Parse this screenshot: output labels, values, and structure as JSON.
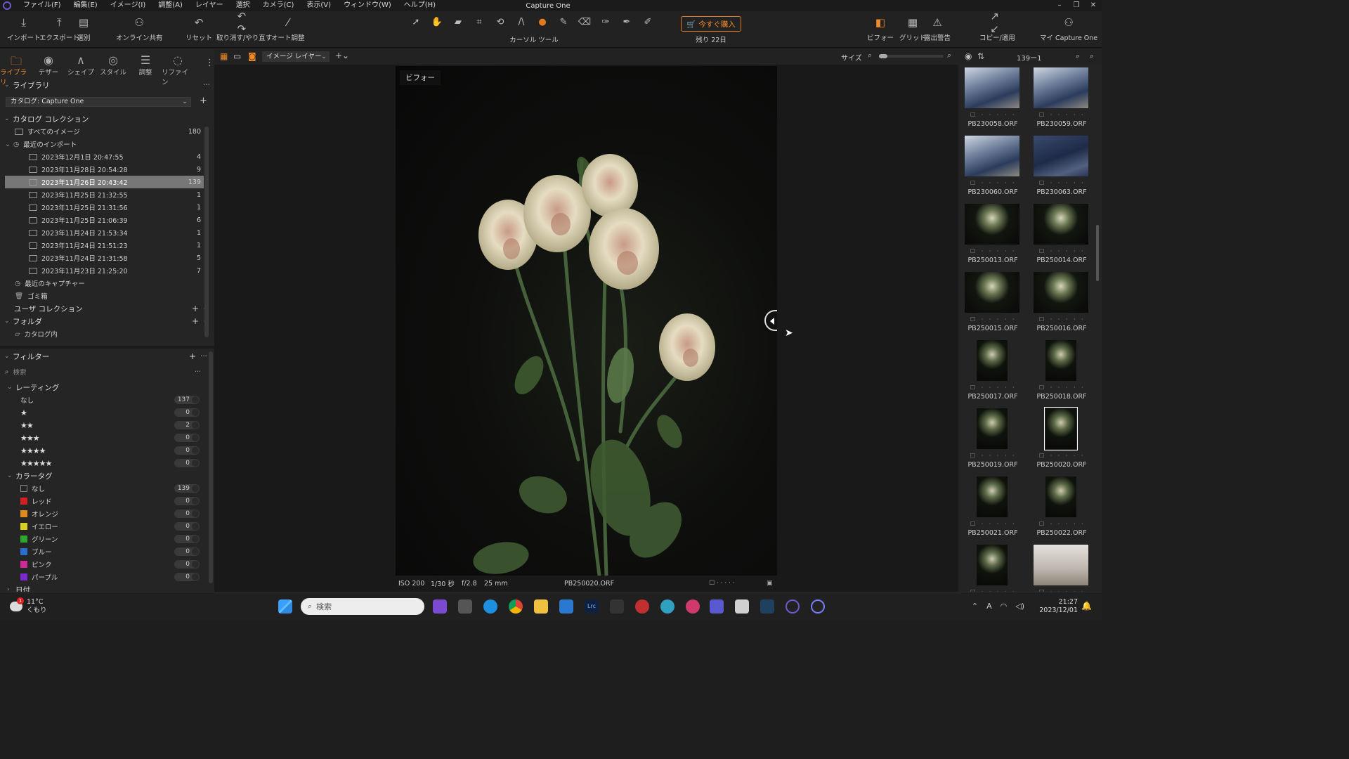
{
  "app": {
    "title": "Capture One",
    "menu": [
      "ファイル(F)",
      "編集(E)",
      "イメージ(I)",
      "調整(A)",
      "レイヤー",
      "選択",
      "カメラ(C)",
      "表示(V)",
      "ウィンドウ(W)",
      "ヘルプ(H)"
    ],
    "window_controls": [
      "–",
      "❐",
      "✕"
    ]
  },
  "toolbar": {
    "import": "インポート",
    "export": "エクスポート",
    "select": "選別",
    "online_share": "オンライン共有",
    "reset": "リセット",
    "undo_redo": "取り消す/やり直す",
    "auto_adjust": "オート調整",
    "cursor_tools": "カーソル ツール",
    "buy_now": "今すぐ購入",
    "days_left": "残り 22日",
    "before": "ビフォー",
    "grid": "グリッド",
    "exposure_warning": "露出警告",
    "copy_apply": "コピー/適用",
    "my_capture_one": "マイ Capture One"
  },
  "left_panel": {
    "tabs": [
      {
        "label": "ライブラリ",
        "icon": "folder-icon",
        "glyph": "🗀"
      },
      {
        "label": "テザー",
        "icon": "camera-icon",
        "glyph": "◉"
      },
      {
        "label": "シェイプ",
        "icon": "shape-icon",
        "glyph": "∧"
      },
      {
        "label": "スタイル",
        "icon": "style-icon",
        "glyph": "◎"
      },
      {
        "label": "調整",
        "icon": "sliders-icon",
        "glyph": "☰"
      },
      {
        "label": "リファイン",
        "icon": "refine-icon",
        "glyph": "◌"
      }
    ],
    "library": {
      "title": "ライブラリ",
      "catalog_select": "カタログ: Capture One",
      "catalog_collections": "カタログ コレクション",
      "all_images": {
        "label": "すべてのイメージ",
        "count": "180"
      },
      "recent_imports": "最近のインポート",
      "imports": [
        {
          "label": "2023年12月1日 20:47:55",
          "count": "4"
        },
        {
          "label": "2023年11月28日 20:54:28",
          "count": "9"
        },
        {
          "label": "2023年11月26日 20:43:42",
          "count": "139"
        },
        {
          "label": "2023年11月25日 21:32:55",
          "count": "1"
        },
        {
          "label": "2023年11月25日 21:31:56",
          "count": "1"
        },
        {
          "label": "2023年11月25日 21:06:39",
          "count": "6"
        },
        {
          "label": "2023年11月24日 21:53:34",
          "count": "1"
        },
        {
          "label": "2023年11月24日 21:51:23",
          "count": "1"
        },
        {
          "label": "2023年11月24日 21:31:58",
          "count": "5"
        },
        {
          "label": "2023年11月23日 21:25:20",
          "count": "7"
        }
      ],
      "recent_captures": "最近のキャプチャー",
      "trash": "ゴミ箱",
      "user_collections": "ユーザ コレクション",
      "folders": "フォルダ",
      "in_catalog": "カタログ内"
    },
    "filters": {
      "title": "フィルター",
      "search_placeholder": "検索",
      "rating_title": "レーティング",
      "ratings": [
        {
          "label": "なし",
          "stars": "",
          "count": "137"
        },
        {
          "label": "",
          "stars": "★",
          "count": "0"
        },
        {
          "label": "",
          "stars": "★★",
          "count": "2"
        },
        {
          "label": "",
          "stars": "★★★",
          "count": "0"
        },
        {
          "label": "",
          "stars": "★★★★",
          "count": "0"
        },
        {
          "label": "",
          "stars": "★★★★★",
          "count": "0"
        }
      ],
      "color_tag_title": "カラータグ",
      "color_tags": [
        {
          "label": "なし",
          "color": "none",
          "count": "139"
        },
        {
          "label": "レッド",
          "color": "#d42020",
          "count": "0"
        },
        {
          "label": "オレンジ",
          "color": "#e08a1a",
          "count": "0"
        },
        {
          "label": "イエロー",
          "color": "#d8d020",
          "count": "0"
        },
        {
          "label": "グリーン",
          "color": "#2ea82e",
          "count": "0"
        },
        {
          "label": "ブルー",
          "color": "#2a6fd0",
          "count": "0"
        },
        {
          "label": "ピンク",
          "color": "#d02a9a",
          "count": "0"
        },
        {
          "label": "パープル",
          "color": "#7a2ad0",
          "count": "0"
        }
      ],
      "date_title": "日付"
    }
  },
  "viewer": {
    "layer_select": "イメージ レイヤー",
    "size_label": "サイズ",
    "before_label": "ビフォー",
    "iso": "ISO 200",
    "shutter": "1/30 秒",
    "aperture": "f/2.8",
    "focal": "25 mm",
    "filename": "PB250020.ORF"
  },
  "browser": {
    "count_label": "139ー1",
    "thumbs": [
      {
        "name": "PB230058.ORF",
        "kind": "cat"
      },
      {
        "name": "PB230059.ORF",
        "kind": "cat"
      },
      {
        "name": "PB230060.ORF",
        "kind": "cat"
      },
      {
        "name": "PB230063.ORF",
        "kind": "cat2"
      },
      {
        "name": "PB250013.ORF",
        "kind": "flower"
      },
      {
        "name": "PB250014.ORF",
        "kind": "flower"
      },
      {
        "name": "PB250015.ORF",
        "kind": "flower"
      },
      {
        "name": "PB250016.ORF",
        "kind": "flower"
      },
      {
        "name": "PB250017.ORF",
        "kind": "flower-narrow"
      },
      {
        "name": "PB250018.ORF",
        "kind": "flower-narrow"
      },
      {
        "name": "PB250019.ORF",
        "kind": "flower-narrow"
      },
      {
        "name": "PB250020.ORF",
        "kind": "flower-narrow",
        "selected": true
      },
      {
        "name": "PB250021.ORF",
        "kind": "flower-narrow"
      },
      {
        "name": "PB250022.ORF",
        "kind": "flower-narrow"
      },
      {
        "name": "",
        "kind": "flower-narrow"
      },
      {
        "name": "",
        "kind": "room"
      }
    ]
  },
  "taskbar": {
    "temp": "11°C",
    "weather": "くもり",
    "search_placeholder": "検索",
    "time": "21:27",
    "date": "2023/12/01",
    "ime": "A"
  }
}
